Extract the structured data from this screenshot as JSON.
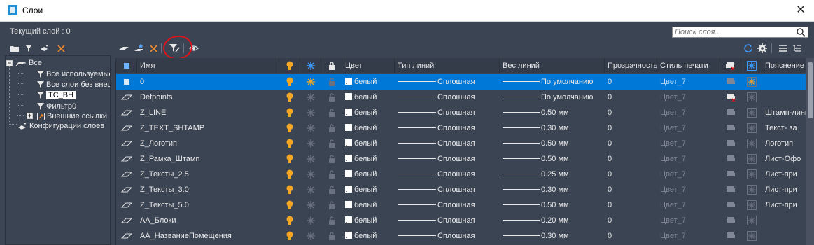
{
  "window": {
    "title": "Слои",
    "close_icon": "close-icon"
  },
  "current_layer": "Текущий слой : 0",
  "search": {
    "placeholder": "Поиск слоя..."
  },
  "tree": {
    "all": "Все",
    "all_used": "Все используемые слои",
    "all_without_xref": "Все слои без внешних ссылок",
    "filter_tc_vn": "ТС_ВН",
    "filter0": "Фильтр0",
    "xrefs": "Внешние ссылки",
    "configs": "Конфигурации слоев"
  },
  "columns": {
    "status": "",
    "name": "Имя",
    "on": "",
    "freeze": "",
    "lock": "",
    "color": "Цвет",
    "linetype": "Тип линий",
    "lineweight": "Вес линий",
    "transparency": "Прозрачность",
    "plotstyle": "Стиль печати",
    "plot": "",
    "newvp": "",
    "description": "Пояснение"
  },
  "accent": {
    "selection": "#0078d7",
    "bulb": "#f5a623",
    "sun_active": "#2c8be8",
    "annotation": "#e0121a"
  },
  "rows": [
    {
      "name": "0",
      "color": "белый",
      "linetype": "Сплошная",
      "lineweight": "По умолчанию",
      "transparency": "0",
      "plotstyle": "Цвет_7",
      "description": "",
      "selected": true,
      "plottable": true
    },
    {
      "name": "Defpoints",
      "color": "белый",
      "linetype": "Сплошная",
      "lineweight": "По умолчанию",
      "transparency": "0",
      "plotstyle": "Цвет_7",
      "description": "",
      "selected": false,
      "plottable": false
    },
    {
      "name": "Z_LINE",
      "color": "белый",
      "linetype": "Сплошная",
      "lineweight": "0.50 мм",
      "transparency": "0",
      "plotstyle": "Цвет_7",
      "description": "Штамп-линии",
      "selected": false,
      "plottable": true
    },
    {
      "name": "Z_TEXT_SHTAMP",
      "color": "белый",
      "linetype": "Сплошная",
      "lineweight": "0.30 мм",
      "transparency": "0",
      "plotstyle": "Цвет_7",
      "description": "Текст- за",
      "selected": false,
      "plottable": true
    },
    {
      "name": "Z_Логотип",
      "color": "белый",
      "linetype": "Сплошная",
      "lineweight": "0.50 мм",
      "transparency": "0",
      "plotstyle": "Цвет_7",
      "description": "Логотип",
      "selected": false,
      "plottable": true
    },
    {
      "name": "Z_Рамка_Штамп",
      "color": "белый",
      "linetype": "Сплошная",
      "lineweight": "0.50 мм",
      "transparency": "0",
      "plotstyle": "Цвет_7",
      "description": "Лист-Офо",
      "selected": false,
      "plottable": true
    },
    {
      "name": "Z_Тексты_2.5",
      "color": "белый",
      "linetype": "Сплошная",
      "lineweight": "0.25 мм",
      "transparency": "0",
      "plotstyle": "Цвет_7",
      "description": "Лист-при",
      "selected": false,
      "plottable": true
    },
    {
      "name": "Z_Тексты_3.0",
      "color": "белый",
      "linetype": "Сплошная",
      "lineweight": "0.30 мм",
      "transparency": "0",
      "plotstyle": "Цвет_7",
      "description": "Лист-при",
      "selected": false,
      "plottable": true
    },
    {
      "name": "Z_Тексты_5.0",
      "color": "белый",
      "linetype": "Сплошная",
      "lineweight": "0.50 мм",
      "transparency": "0",
      "plotstyle": "Цвет_7",
      "description": "Лист-при",
      "selected": false,
      "plottable": true
    },
    {
      "name": "АА_Блоки",
      "color": "белый",
      "linetype": "Сплошная",
      "lineweight": "0.20 мм",
      "transparency": "0",
      "plotstyle": "Цвет_7",
      "description": "",
      "selected": false,
      "plottable": true
    },
    {
      "name": "АА_НазваниеПомещения",
      "color": "белый",
      "linetype": "Сплошная",
      "lineweight": "0.30 мм",
      "transparency": "0",
      "plotstyle": "Цвет_7",
      "description": "",
      "selected": false,
      "plottable": true
    }
  ]
}
